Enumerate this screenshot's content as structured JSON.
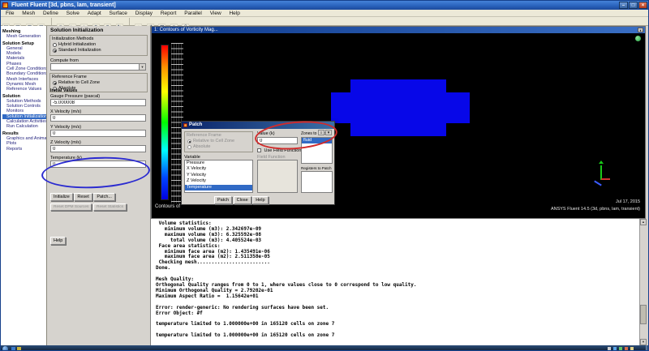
{
  "window": {
    "title": "Fluent Fluent [3d, pbns, lam, transient]"
  },
  "glyphs": {
    "minimize": "–",
    "maximize": "□",
    "close": "×",
    "dropdown": "▼",
    "up": "▲",
    "down": "▼",
    "menu": "≡"
  },
  "menu": {
    "items": [
      "File",
      "Mesh",
      "Define",
      "Solve",
      "Adapt",
      "Surface",
      "Display",
      "Report",
      "Parallel",
      "View",
      "Help"
    ]
  },
  "toolbar": {
    "icons": [
      {
        "name": "open",
        "glyph": "▤"
      },
      {
        "name": "save",
        "glyph": "▦"
      },
      {
        "name": "journal",
        "glyph": "▧"
      },
      {
        "name": "print",
        "glyph": "▥"
      },
      {
        "name": "snapshot",
        "glyph": "◉"
      },
      {
        "name": "pointer",
        "glyph": "►"
      },
      {
        "name": "pan",
        "glyph": "+"
      },
      {
        "name": "zoom-in",
        "glyph": "⊕"
      },
      {
        "name": "zoom-out",
        "glyph": "⊖"
      },
      {
        "name": "rotate",
        "glyph": "↻"
      },
      {
        "name": "fit-view",
        "glyph": "⌂"
      },
      {
        "name": "previous-view",
        "glyph": "↺"
      },
      {
        "name": "grid",
        "glyph": "▩"
      },
      {
        "name": "info",
        "glyph": "≡"
      },
      {
        "name": "help",
        "glyph": "?"
      }
    ]
  },
  "tree": {
    "selected_item": "Solution Initialization",
    "sections": [
      {
        "header": "Meshing",
        "items": [
          "Mesh Generation"
        ]
      },
      {
        "header": "Solution Setup",
        "items": [
          "General",
          "Models",
          "Materials",
          "Phases",
          "Cell Zone Conditions",
          "Boundary Conditions",
          "Mesh Interfaces",
          "Dynamic Mesh",
          "Reference Values"
        ]
      },
      {
        "header": "Solution",
        "items": [
          "Solution Methods",
          "Solution Controls",
          "Monitors",
          "Solution Initialization",
          "Calculation Activities",
          "Run Calculation"
        ]
      },
      {
        "header": "Results",
        "items": [
          "Graphics and Animations",
          "Plots",
          "Reports"
        ]
      }
    ]
  },
  "panel": {
    "title": "Solution Initialization",
    "init_methods_label": "Initialization Methods",
    "methods": [
      "Hybrid Initialization",
      "Standard Initialization"
    ],
    "selected_method": "Standard Initialization",
    "compute_from_label": "Compute from",
    "compute_from_value": "",
    "reference_frame_label": "Reference Frame",
    "ref_options": [
      "Relative to Cell Zone",
      "Absolute"
    ],
    "selected_reference_frame": "Relative to Cell Zone",
    "initial_values_label": "Initial Values",
    "fields": [
      {
        "label": "Gauge Pressure (pascal)",
        "value": "-5.000008"
      },
      {
        "label": "X Velocity (m/s)",
        "value": "0"
      },
      {
        "label": "Y Velocity (m/s)",
        "value": "0"
      },
      {
        "label": "Z Velocity (m/s)",
        "value": "0"
      },
      {
        "label": "Temperature (k)",
        "value": "0"
      }
    ],
    "buttons": [
      "Initialize",
      "Reset",
      "Patch..."
    ],
    "buttons2": [
      "Reset DPM Sources",
      "Reset Statistics"
    ],
    "help_label": "Help"
  },
  "graphics": {
    "window_title": "1: Contours of Vorticity Mag...",
    "caption": "Contours of",
    "date": "Jul 17, 2015",
    "app_label": "ANSYS Fluent 14.5 (3d, pbns, lam, transient)",
    "colorbar_colors": [
      "#ff0000",
      "#ff9100",
      "#ffff00",
      "#00ff00",
      "#00ffff",
      "#0000e0"
    ],
    "geometry_color": "#0707e8"
  },
  "dialog": {
    "title": "Patch",
    "reference_frame_label": "Reference Frame",
    "ref_options": [
      "Relative to Cell Zone",
      "Absolute"
    ],
    "value_label": "Value (k)",
    "value": "0",
    "use_field_function_label": "Use Field Function",
    "field_function_label": "Field Function",
    "variable_label": "Variable",
    "variables": [
      "Pressure",
      "X Velocity",
      "Y Velocity",
      "Z Velocity",
      "Temperature"
    ],
    "selected_variable": "Temperature",
    "zones_label": "Zones to Patch",
    "zones": [
      "fluid"
    ],
    "selected_zone": "fluid",
    "registers_label": "Registers to Patch",
    "buttons": [
      "Patch",
      "Close",
      "Help"
    ]
  },
  "console": {
    "text": " Volume statistics:\n   minimum volume (m3): 2.342697e-09\n   maximum volume (m3): 6.325592e-08\n     total volume (m3): 4.405524e-03\n Face area statistics:\n   minimum face area (m2): 1.435491e-06\n   maximum face area (m2): 2.511358e-05\n Checking mesh.........................\nDone.\n\nMesh Quality:\nOrthogonal Quality ranges from 0 to 1, where values close to 0 correspond to low quality.\nMinimum Orthogonal Quality = 2.79202e-01\nMaximum Aspect Ratio =  1.15642e+01\n\nError: render-generic: No rendering surfaces have been set.\nError Object: #f\n\ntemperature limited to 1.000000e+00 in 165120 cells on zone 7\n\ntemperature limited to 1.000000e+00 in 165120 cells on zone 7"
  },
  "annotations": {
    "temperature_circle_color": "#2b2bd0",
    "value_circle_color": "#d02b2b"
  }
}
